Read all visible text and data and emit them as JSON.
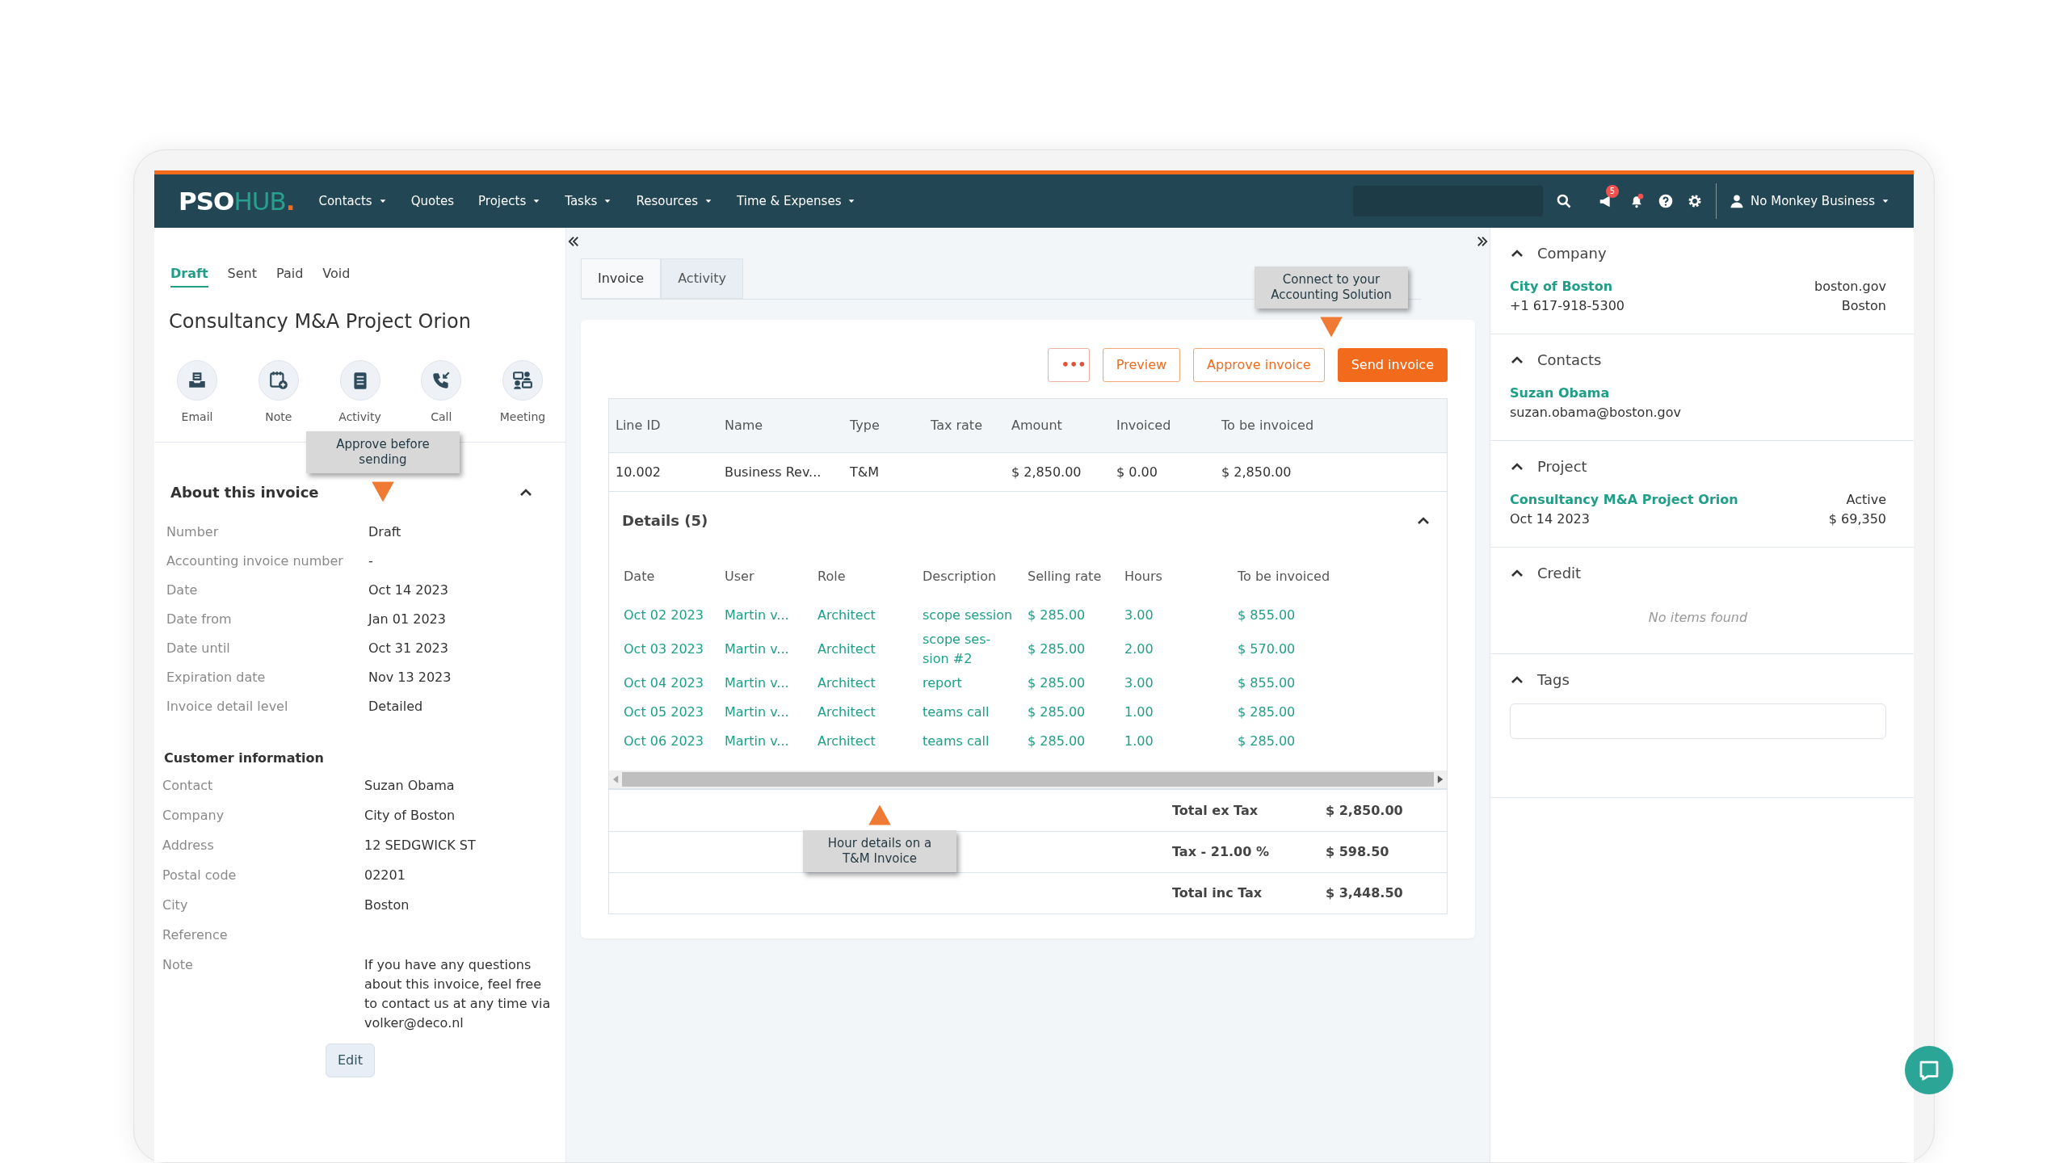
{
  "navbar": {
    "logo": {
      "main": "PSO",
      "accent": "HUB",
      "dot": "."
    },
    "menu": [
      {
        "label": "Contacts",
        "dropdown": true
      },
      {
        "label": "Quotes",
        "dropdown": false
      },
      {
        "label": "Projects",
        "dropdown": true
      },
      {
        "label": "Tasks",
        "dropdown": true
      },
      {
        "label": "Resources",
        "dropdown": true
      },
      {
        "label": "Time & Expenses",
        "dropdown": true
      }
    ],
    "notification_count": "5",
    "user": "No Monkey Business"
  },
  "left_panel": {
    "status_tabs": [
      {
        "label": "Draft",
        "selected": true
      },
      {
        "label": "Sent",
        "selected": false
      },
      {
        "label": "Paid",
        "selected": false
      },
      {
        "label": "Void",
        "selected": false
      }
    ],
    "title": "Consultancy M&A Project Orion",
    "actions": [
      {
        "label": "Email",
        "kind": "email"
      },
      {
        "label": "Note",
        "kind": "note"
      },
      {
        "label": "Activity",
        "kind": "activity"
      },
      {
        "label": "Call",
        "kind": "call"
      },
      {
        "label": "Meeting",
        "kind": "meeting"
      }
    ],
    "callout": {
      "text": "Approve before sending",
      "pointer_up": false
    },
    "about": {
      "title": "About this invoice",
      "expanded": true,
      "fields": [
        {
          "label": "Number",
          "value": "Draft"
        },
        {
          "label": "Accounting invoice number",
          "value": "-"
        },
        {
          "label": "Date",
          "value": "Oct 14 2023"
        },
        {
          "label": "Date from",
          "value": "Jan 01 2023"
        },
        {
          "label": "Date until",
          "value": "Oct 31 2023"
        },
        {
          "label": "Expiration date",
          "value": "Nov 13 2023"
        },
        {
          "label": "Invoice detail level",
          "value": "Detailed"
        }
      ]
    },
    "customer": {
      "title": "Customer information",
      "fields": [
        {
          "label": "Contact",
          "value": "Suzan Obama"
        },
        {
          "label": "Company",
          "value": "City of Boston"
        },
        {
          "label": "Address",
          "value": "12 SEDGWICK ST"
        },
        {
          "label": "Postal code",
          "value": "02201"
        },
        {
          "label": "City",
          "value": "Boston"
        },
        {
          "label": "Reference"
        },
        {
          "label": "Note",
          "value": "If you have any questions about this invoice, feel free to contact us at any time via volker@deco.nl"
        }
      ]
    },
    "edit_button": "Edit"
  },
  "invoice": {
    "tabs": [
      {
        "label": "Invoice",
        "selected": true
      },
      {
        "label": "Activity",
        "selected": false
      }
    ],
    "callout": {
      "text": "Connect to your Accounting Solution",
      "pointer_up": false
    },
    "buttons": [
      {
        "label": "•••",
        "kind": "more"
      },
      {
        "label": "Preview",
        "kind": "outline"
      },
      {
        "label": "Approve invoice",
        "kind": "outline"
      },
      {
        "label": "Send invoice",
        "kind": "primary"
      }
    ],
    "table": {
      "columns": [
        "Line ID",
        "Name",
        "Type",
        "Tax rate",
        "Amount",
        "Invoiced",
        "To be invoiced"
      ],
      "rows": [
        [
          "10.002",
          "Business Rev...",
          "T&M",
          "",
          "$ 2,850.00",
          "$ 0.00",
          "$ 2,850.00"
        ]
      ]
    },
    "details": {
      "title": "Details (5)",
      "expanded": true,
      "columns": [
        "Date",
        "User",
        "Role",
        "Description",
        "Selling rate",
        "Hours",
        "To be invoiced"
      ],
      "rows": [
        [
          "Oct 02 2023",
          "Martin v...",
          "Architect",
          "scope session",
          "$ 285.00",
          "3.00",
          "$ 855.00"
        ],
        [
          "Oct 03 2023",
          "Martin v...",
          "Architect",
          "scope ses-sion #2",
          "$ 285.00",
          "2.00",
          "$ 570.00"
        ],
        [
          "Oct 04 2023",
          "Martin v...",
          "Architect",
          "report",
          "$ 285.00",
          "3.00",
          "$ 855.00"
        ],
        [
          "Oct 05 2023",
          "Martin v...",
          "Architect",
          "teams call",
          "$ 285.00",
          "1.00",
          "$ 285.00"
        ],
        [
          "Oct 06 2023",
          "Martin v...",
          "Architect",
          "teams call",
          "$ 285.00",
          "1.00",
          "$ 285.00"
        ]
      ]
    },
    "totals_callout": {
      "text": "Hour details on a T&M Invoice",
      "pointer_up": true
    },
    "totals": [
      {
        "label": "Total ex Tax",
        "value": "$ 2,850.00"
      },
      {
        "label": "Tax - 21.00 %",
        "value": "$ 598.50"
      },
      {
        "label": "Total inc Tax",
        "value": "$ 3,448.50"
      }
    ]
  },
  "right_panel": {
    "sections": [
      {
        "title": "Company",
        "expanded": true,
        "kind": "pair",
        "link": "City of Boston",
        "sub": "+1 617-918-5300",
        "right_top": "boston.gov",
        "right_bottom": "Boston"
      },
      {
        "title": "Contacts",
        "expanded": true,
        "kind": "pair",
        "link": "Suzan Obama",
        "sub": "suzan.obama@boston.gov"
      },
      {
        "title": "Project",
        "expanded": true,
        "kind": "pair",
        "link": "Consultancy M&A Project Orion",
        "sub": "Oct 14 2023",
        "right_top": "Active",
        "right_bottom": "$ 69,350"
      },
      {
        "title": "Credit",
        "expanded": true,
        "kind": "empty",
        "message": "No items found"
      },
      {
        "title": "Tags",
        "expanded": true,
        "kind": "tags"
      }
    ]
  }
}
